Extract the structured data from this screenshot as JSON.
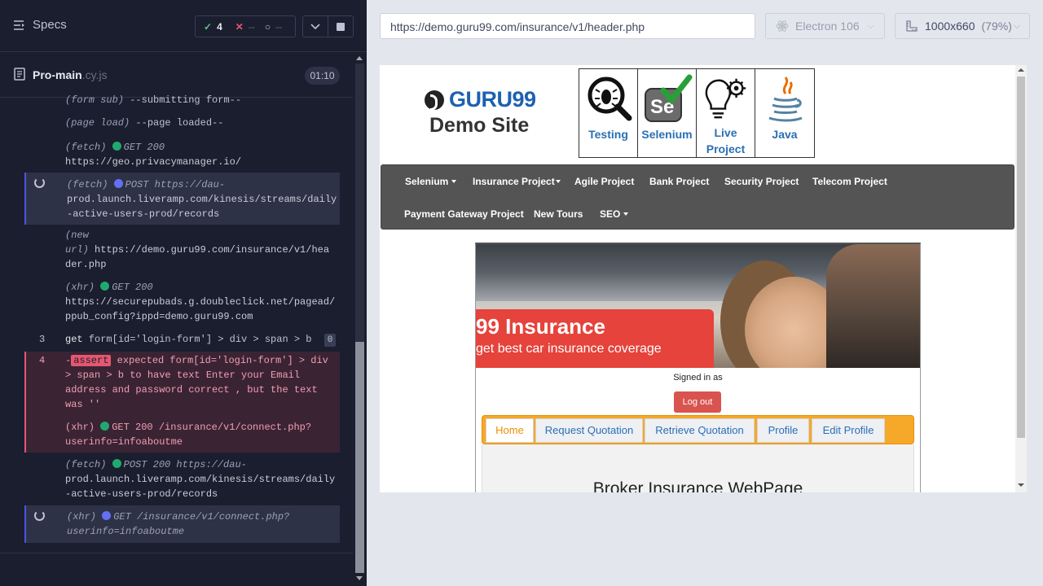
{
  "reporter": {
    "specs_label": "Specs",
    "passed_count": "4",
    "failed_count": "--",
    "pending_count": "--",
    "spec_file": {
      "name": "Pro-main",
      "ext": ".cy.js",
      "duration": "01:10"
    },
    "logs": [
      {
        "kind": "(form sub)",
        "text": "--submitting form--"
      },
      {
        "kind": "(page load)",
        "text": "--page loaded--"
      },
      {
        "kind": "(fetch)",
        "status": "GET 200",
        "url": "https://geo.privacymanager.io/"
      },
      {
        "kind": "(fetch)",
        "status": "POST https://dau-",
        "url": "prod.launch.liveramp.com/kinesis/streams/daily",
        "url2": "-active-users-prod/records"
      },
      {
        "kind": "(new",
        "kind2": "url)",
        "url": "https://demo.guru99.com/insurance/v1/hea",
        "url2": "der.php"
      },
      {
        "kind": "(xhr)",
        "status": "GET 200",
        "url": "https://securepubads.g.doubleclick.net/pagead/",
        "url2": "ppub_config?ippd=demo.guru99.com"
      }
    ],
    "cmd_get": {
      "num": "3",
      "name": "get",
      "selector": "form[id='login-form'] > div > span > b",
      "badge": "0"
    },
    "cmd_assert": {
      "num": "4",
      "prefix": "-",
      "tag": "assert",
      "line1": "expected form[id='login-form'] > div",
      "line2": "> span > b  to have text  Enter your Email",
      "line3": "address and password correct , but the text",
      "line4": "was  ''",
      "xhr_kind": "(xhr)",
      "xhr_status": "GET 200 /insurance/v1/connect.php?",
      "xhr_url2": "userinfo=infoaboutme"
    },
    "log_fetch2": {
      "kind": "(fetch)",
      "status": "POST 200 https://dau-",
      "url": "prod.launch.liveramp.com/kinesis/streams/daily",
      "url2": "-active-users-prod/records"
    },
    "log_xhr_pending": {
      "kind": "(xhr)",
      "status": "GET /insurance/v1/connect.php?",
      "url2": "userinfo=infoaboutme"
    }
  },
  "aut": {
    "url": "https://demo.guru99.com/insurance/v1/header.php",
    "browser": "Electron 106",
    "viewport": "1000x660",
    "zoom": "(79%)"
  },
  "site": {
    "logo_text": "GURU99",
    "subtitle": "Demo Site",
    "categories": [
      {
        "label": "Testing"
      },
      {
        "label": "Selenium"
      },
      {
        "label": "Live Project"
      },
      {
        "label": "Java"
      }
    ],
    "nav": [
      "Selenium",
      "Insurance Project",
      "Agile Project",
      "Bank Project",
      "Security Project",
      "Telecom Project",
      "Payment Gateway Project",
      "New Tours",
      "SEO"
    ],
    "hero_title": "99 Insurance",
    "hero_sub": "get best car insurance coverage",
    "signed_in": "Signed in as",
    "logout": "Log out",
    "tabs": [
      "Home",
      "Request Quotation",
      "Retrieve Quotation",
      "Profile",
      "Edit Profile"
    ],
    "broker_heading": "Broker Insurance WebPage"
  },
  "colors": {
    "accent_fail": "#e45770",
    "pass": "#1fa971",
    "pending": "#6470f3",
    "tab_bar": "#f6a828",
    "banner": "#e5433b"
  }
}
